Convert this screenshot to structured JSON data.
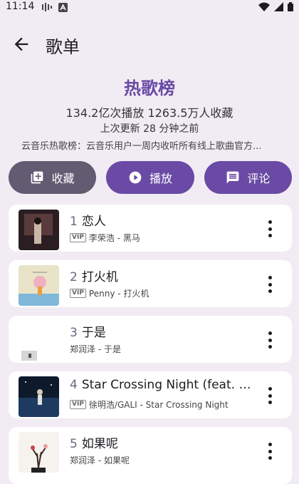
{
  "status": {
    "time": "11:14"
  },
  "appbar": {
    "title": "歌单"
  },
  "playlist": {
    "title": "热歌榜",
    "stats": "134.2亿次播放 1263.5万人收藏",
    "updated": "上次更新 28 分钟之前",
    "description": "云音乐热歌榜：云音乐用户一周内收听所有线上歌曲官方..."
  },
  "actions": {
    "favorite": "收藏",
    "play": "播放",
    "comment": "评论"
  },
  "songs": [
    {
      "index": "1",
      "title": "恋人",
      "vip": true,
      "subtitle": "李荣浩 - 黑马"
    },
    {
      "index": "2",
      "title": "打火机",
      "vip": true,
      "subtitle": "Penny - 打火机"
    },
    {
      "index": "3",
      "title": "于是",
      "vip": false,
      "subtitle": "郑润泽 - 于是"
    },
    {
      "index": "4",
      "title": "Star Crossing Night (feat. GALI)",
      "vip": true,
      "subtitle": "徐明浩/GALI - Star Crossing Night"
    },
    {
      "index": "5",
      "title": "如果呢",
      "vip": false,
      "subtitle": "郑润泽 - 如果呢"
    }
  ],
  "vip_label": "VIP",
  "colors": {
    "primary": "#6a4aa4",
    "secondary": "#625b71",
    "background": "#f1ecf4"
  }
}
